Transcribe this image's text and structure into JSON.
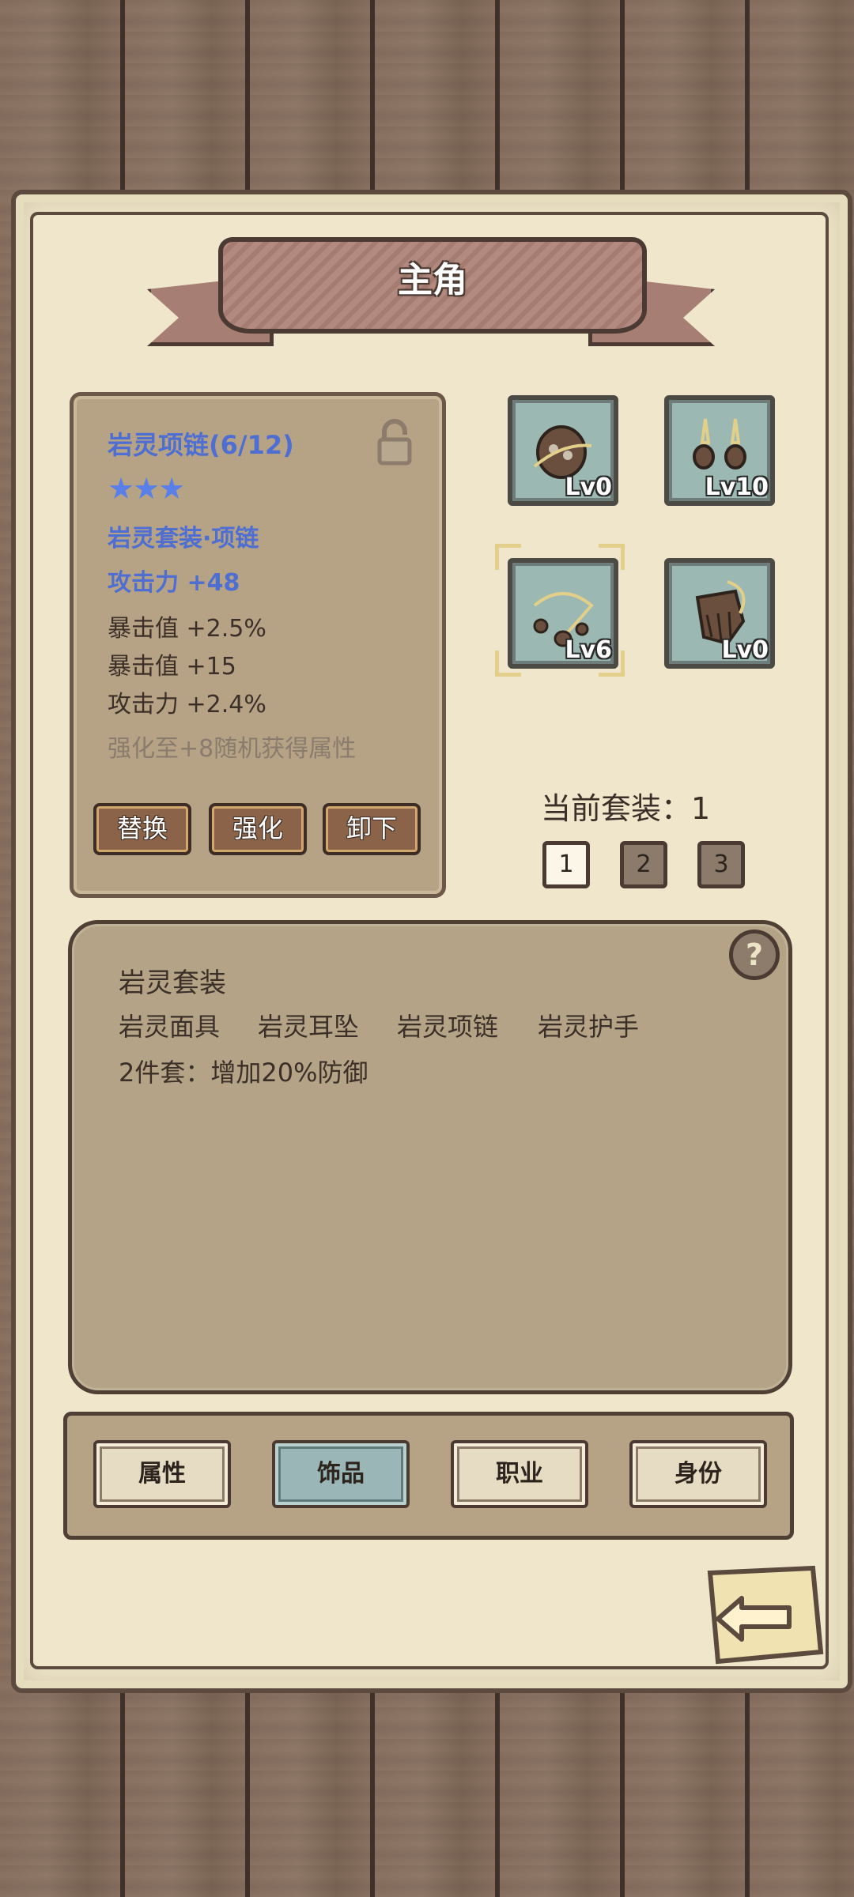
{
  "header": {
    "title": "主角"
  },
  "item": {
    "name": "岩灵项链(6/12)",
    "stars": "★★★",
    "set_name": "岩灵套装·项链",
    "main_stat": "攻击力 +48",
    "sub_stats": [
      "暴击值 +2.5%",
      "暴击值 +15",
      "攻击力 +2.4%"
    ],
    "hint": "强化至+8随机获得属性",
    "locked": false,
    "buttons": {
      "replace": "替换",
      "enhance": "强化",
      "unequip": "卸下"
    }
  },
  "slots": [
    {
      "label": "Lv0",
      "icon": "rock-helmet-icon"
    },
    {
      "label": "Lv10",
      "icon": "rock-earring-icon"
    },
    {
      "label": "Lv6",
      "icon": "rock-necklace-icon",
      "selected": true
    },
    {
      "label": "Lv0",
      "icon": "rock-gauntlet-icon"
    }
  ],
  "current_set": {
    "label": "当前套装：1",
    "tabs": [
      "1",
      "2",
      "3"
    ],
    "active_tab": "1"
  },
  "set_info": {
    "title": "岩灵套装",
    "pieces": [
      "岩灵面具",
      "岩灵耳坠",
      "岩灵项链",
      "岩灵护手"
    ],
    "bonus": "2件套：增加20%防御",
    "help": "?"
  },
  "tabs": [
    {
      "label": "属性",
      "active": false
    },
    {
      "label": "饰品",
      "active": true
    },
    {
      "label": "职业",
      "active": false
    },
    {
      "label": "身份",
      "active": false
    }
  ],
  "colors": {
    "parchment": "#ede3c7",
    "card": "#b6a386",
    "highlight_text": "#4e6fd1",
    "slot_bg": "#9bb8b3",
    "ribbon": "#a77e74"
  }
}
